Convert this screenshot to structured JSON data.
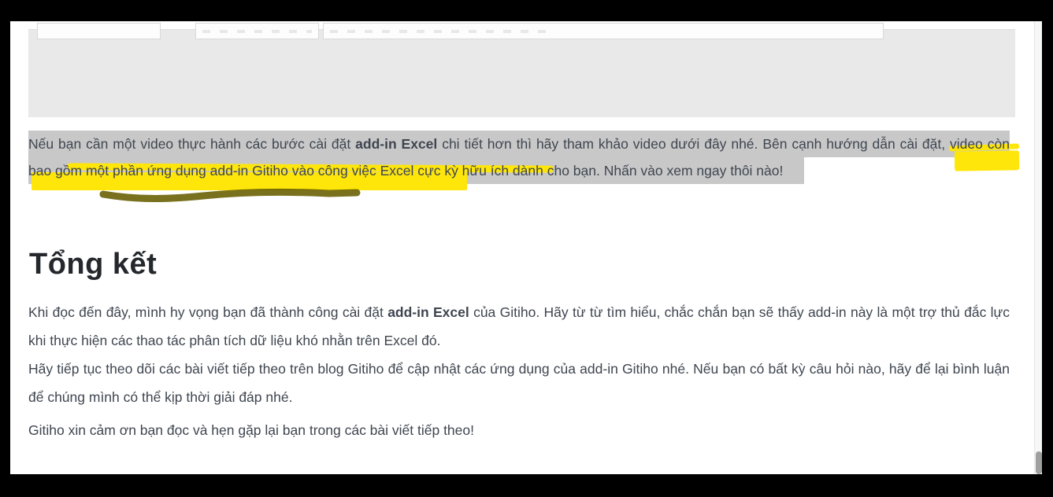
{
  "theme": {
    "frame_color": "#000000",
    "page_bg": "#ffffff",
    "image_placeholder_bg": "#e9e9e9",
    "selection_color": "#c8c8c8",
    "highlighter_yellow": "#ffe60a",
    "highlighter_dark": "#6a6206",
    "text_color": "#3f4650",
    "heading_color": "#24282c"
  },
  "article": {
    "selected_paragraph": {
      "segments": [
        {
          "text": "Nếu bạn cần một video thực hành các bước cài đặt ",
          "bold": false
        },
        {
          "text": "add-in Excel",
          "bold": true
        },
        {
          "text": " chi tiết hơn thì hãy tham khảo video dưới đây nhé. Bên cạnh hướng dẫn cài đặt, video còn bao gồm một phần ứng dụng add-in Gitiho vào công việc Excel cực kỳ hữu ích dành cho bạn. Nhấn vào xem ngay thôi nào!",
          "bold": false
        }
      ]
    },
    "heading": "Tổng kết",
    "paragraph_1": {
      "segments": [
        {
          "text": "Khi đọc đến đây, mình hy vọng bạn đã thành công cài đặt ",
          "bold": false
        },
        {
          "text": "add-in Excel",
          "bold": true
        },
        {
          "text": " của Gitiho. Hãy từ từ tìm hiểu, chắc chắn bạn sẽ thấy add-in này là một trợ thủ đắc lực khi thực hiện các thao tác phân tích dữ liệu khó nhằn trên Excel đó.",
          "bold": false
        }
      ]
    },
    "paragraph_2": {
      "segments": [
        {
          "text": "Hãy tiếp tục theo dõi các bài viết tiếp theo trên blog Gitiho để cập nhật các ứng dụng của add-in Gitiho nhé. Nếu bạn có bất kỳ câu hỏi nào, hãy để lại bình luận để chúng mình có thể kịp thời giải đáp nhé.",
          "bold": false
        }
      ]
    },
    "paragraph_3": {
      "segments": [
        {
          "text": "Gitiho xin cảm ơn bạn đọc và hẹn gặp lại bạn trong các bài viết tiếp theo!",
          "bold": false
        }
      ]
    }
  }
}
